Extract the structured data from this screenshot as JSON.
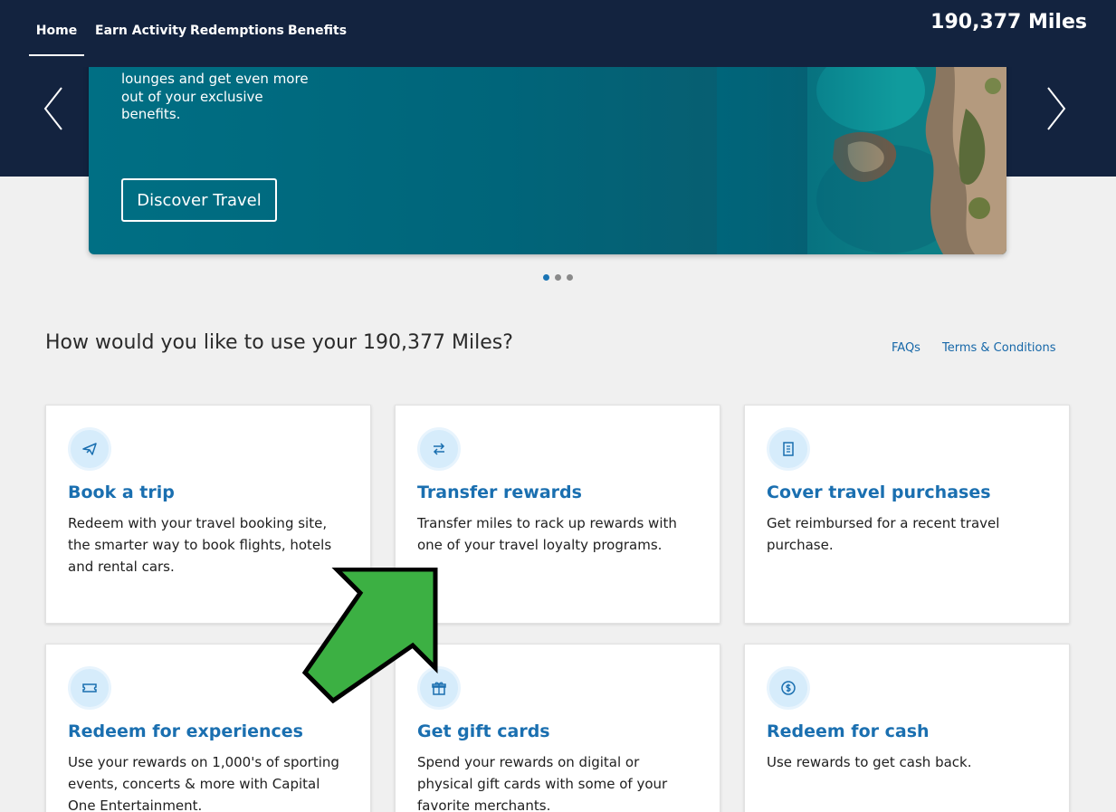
{
  "header": {
    "nav": [
      {
        "label": "Home",
        "active": true
      },
      {
        "label": "Earn Activity",
        "active": false
      },
      {
        "label": "Redemptions",
        "active": false
      },
      {
        "label": "Benefits",
        "active": false
      }
    ],
    "miles_total": "190,377 Miles"
  },
  "hero": {
    "text": "lounges and get even more out of your exclusive benefits.",
    "button_label": "Discover Travel",
    "slide_count": 3,
    "active_slide": 1
  },
  "main": {
    "section_title": "How would you like to use your 190,377 Miles?",
    "links": {
      "faqs": "FAQs",
      "terms": "Terms & Conditions"
    },
    "cards": [
      {
        "icon": "airplane-icon",
        "title": "Book a trip",
        "description": "Redeem with your travel booking site, the smarter way to book flights, hotels and rental cars."
      },
      {
        "icon": "transfer-arrows-icon",
        "title": "Transfer rewards",
        "description": "Transfer miles to rack up rewards with one of your travel loyalty programs."
      },
      {
        "icon": "receipt-icon",
        "title": "Cover travel purchases",
        "description": "Get reimbursed for a recent travel purchase."
      },
      {
        "icon": "ticket-icon",
        "title": "Redeem for experiences",
        "description": "Use your rewards on 1,000's of sporting events, concerts & more with Capital One Entertainment."
      },
      {
        "icon": "gift-icon",
        "title": "Get gift cards",
        "description": "Spend your rewards on digital or physical gift cards with some of your favorite merchants."
      },
      {
        "icon": "dollar-coin-icon",
        "title": "Redeem for cash",
        "description": "Use rewards to get cash back."
      }
    ]
  },
  "colors": {
    "nav_bg": "#13233f",
    "hero_teal": "#006f84",
    "card_title": "#1a6fb0",
    "link": "#1667a8",
    "annotation_arrow": "#3cb043"
  },
  "annotation": {
    "icon": "green-pointer-arrow-icon"
  }
}
